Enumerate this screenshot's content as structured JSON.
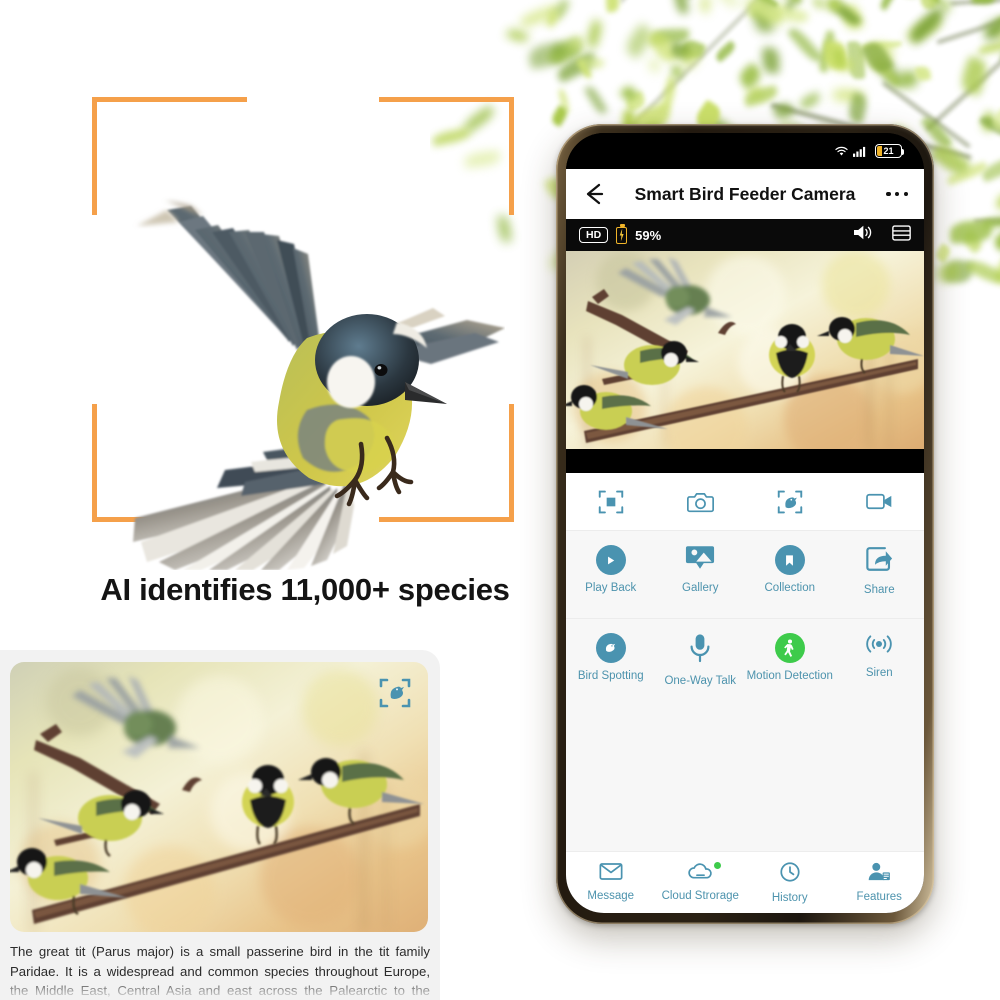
{
  "theme": {
    "accent_teal": "#4a93b0",
    "accent_orange": "#f5a04a",
    "accent_green": "#3ecb4b",
    "battery_yellow": "#f0b429"
  },
  "hero": {
    "headline": "AI identifies 11,000+ species",
    "bracket_color": "#f5a04a",
    "bird_subject": "great-tit-in-flight"
  },
  "info_card": {
    "scan_icon": "bird-scan-icon",
    "photo_subject": "great-tits-on-branch",
    "body_text": "The great tit (Parus major) is a small passerine bird in the tit family Paridae. It is a widespread and common species throughout Europe, the Middle East, Central Asia and east across the Palearctic to the Amur River, south to parts"
  },
  "phone": {
    "statusbar": {
      "wifi_icon": "wifi-icon",
      "signal_icon": "cellular-signal-icon",
      "battery_icon": "battery-icon",
      "battery_level": "21"
    },
    "titlebar": {
      "back_icon": "back-arrow-icon",
      "title": "Smart Bird Feeder Camera",
      "more_icon": "more-options-icon"
    },
    "videobar": {
      "quality_badge": "HD",
      "battery_icon": "battery-charging-icon",
      "battery_percent": "59%",
      "volume_icon": "speaker-icon",
      "layout_icon": "split-screen-icon"
    },
    "video": {
      "subject": "great-tits-on-branch-live-feed"
    },
    "toolrow": [
      {
        "name": "fullscreen-focus-icon",
        "icon": "focus-frame-icon"
      },
      {
        "name": "snapshot-button",
        "icon": "camera-icon"
      },
      {
        "name": "bird-scan-button",
        "icon": "bird-scan-icon"
      },
      {
        "name": "record-button",
        "icon": "video-camera-icon"
      }
    ],
    "features_row1": [
      {
        "label": "Play Back",
        "icon": "play-icon",
        "style": "circle",
        "active": false
      },
      {
        "label": "Gallery",
        "icon": "gallery-icon",
        "style": "glyph",
        "active": false
      },
      {
        "label": "Collection",
        "icon": "bookmark-icon",
        "style": "circle",
        "active": false
      },
      {
        "label": "Share",
        "icon": "share-icon",
        "style": "glyph",
        "active": false
      }
    ],
    "features_row2": [
      {
        "label": "Bird Spotting",
        "icon": "bird-icon",
        "style": "circle",
        "active": false
      },
      {
        "label": "One-Way Talk",
        "icon": "microphone-icon",
        "style": "glyph",
        "active": false
      },
      {
        "label": "Motion Detection",
        "icon": "motion-walk-icon",
        "style": "circle",
        "active": true
      },
      {
        "label": "Siren",
        "icon": "siren-wave-icon",
        "style": "glyph",
        "active": false
      }
    ],
    "bottomnav": [
      {
        "label": "Message",
        "icon": "envelope-icon",
        "badge": false
      },
      {
        "label": "Cloud Strorage",
        "icon": "cloud-icon",
        "badge": true
      },
      {
        "label": "History",
        "icon": "clock-icon",
        "badge": false
      },
      {
        "label": "Features",
        "icon": "person-card-icon",
        "badge": false
      }
    ]
  }
}
